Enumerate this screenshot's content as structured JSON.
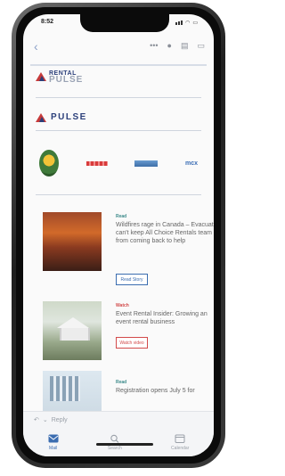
{
  "status": {
    "time": "8:52"
  },
  "toolbar": {
    "back_icon": "chevron-left-icon",
    "more_icon": "ellipsis-icon",
    "mic_icon": "microphone-icon",
    "trash_icon": "trash-icon",
    "archive_icon": "archive-icon"
  },
  "brand": {
    "line1": "RENTAL",
    "line2": "PULSE",
    "pulse": "PULSE"
  },
  "stories": [
    {
      "category": "Read",
      "title": "Wildfires rage in Canada – Evacuation can't keep All Choice Rentals team from coming back to help",
      "button": "Read Story"
    },
    {
      "category": "Watch",
      "title": "Event Rental Insider: Growing an event rental business",
      "button": "Watch video"
    },
    {
      "category": "Read",
      "title": "Registration opens July 5 for"
    }
  ],
  "reply": {
    "label": "Reply"
  },
  "tabs": [
    {
      "label": "Mail"
    },
    {
      "label": "Search"
    },
    {
      "label": "Calendar"
    }
  ]
}
